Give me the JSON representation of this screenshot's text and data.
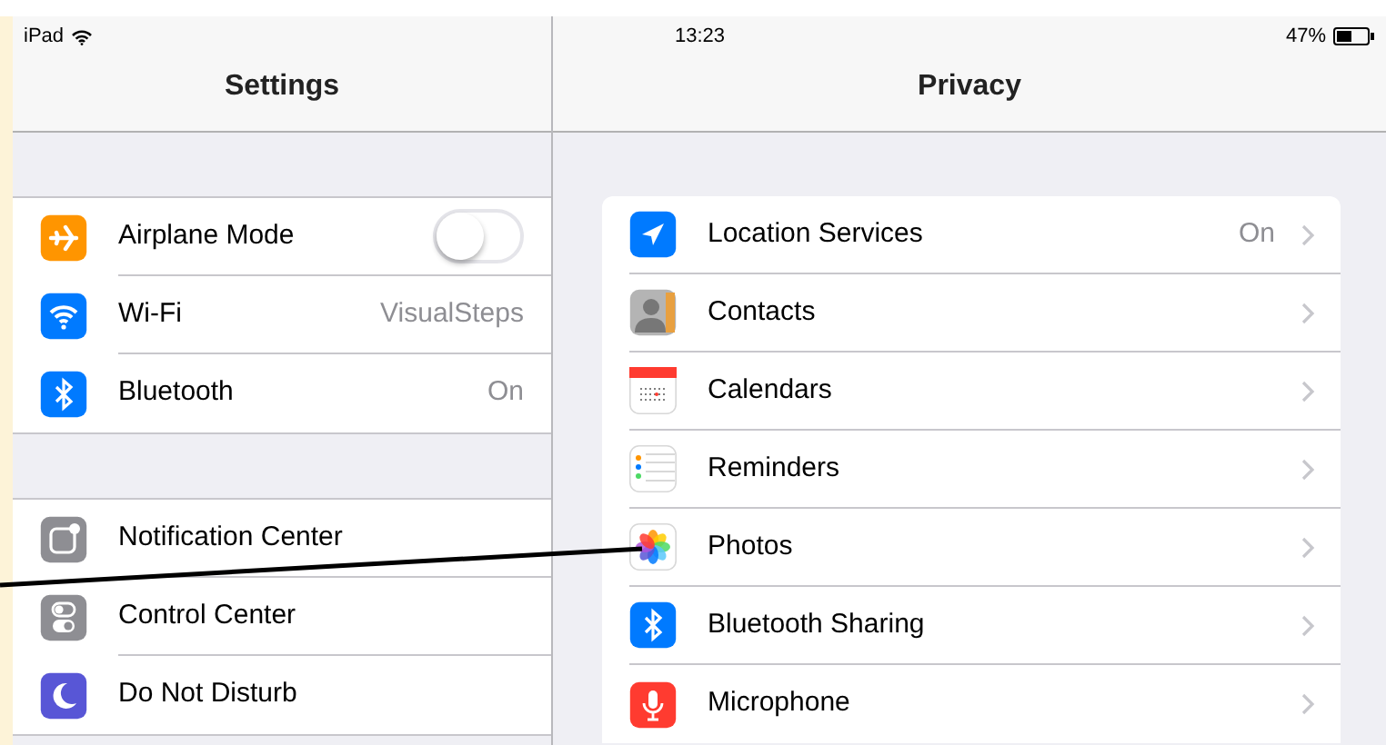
{
  "status_bar": {
    "carrier": "iPad",
    "time": "13:23",
    "battery": "47%"
  },
  "settings_panel": {
    "title": "Settings",
    "groups": [
      {
        "items": [
          {
            "kind": "toggle",
            "label": "Airplane Mode",
            "on": false
          },
          {
            "kind": "value",
            "label": "Wi-Fi",
            "value": "VisualSteps"
          },
          {
            "kind": "value",
            "label": "Bluetooth",
            "value": "On"
          }
        ]
      },
      {
        "items": [
          {
            "kind": "link",
            "label": "Notification Center"
          },
          {
            "kind": "link",
            "label": "Control Center"
          },
          {
            "kind": "link",
            "label": "Do Not Disturb"
          }
        ]
      }
    ]
  },
  "privacy_panel": {
    "title": "Privacy",
    "items": [
      {
        "label": "Location Services",
        "value": "On"
      },
      {
        "label": "Contacts"
      },
      {
        "label": "Calendars"
      },
      {
        "label": "Reminders"
      },
      {
        "label": "Photos"
      },
      {
        "label": "Bluetooth Sharing"
      },
      {
        "label": "Microphone"
      }
    ]
  }
}
